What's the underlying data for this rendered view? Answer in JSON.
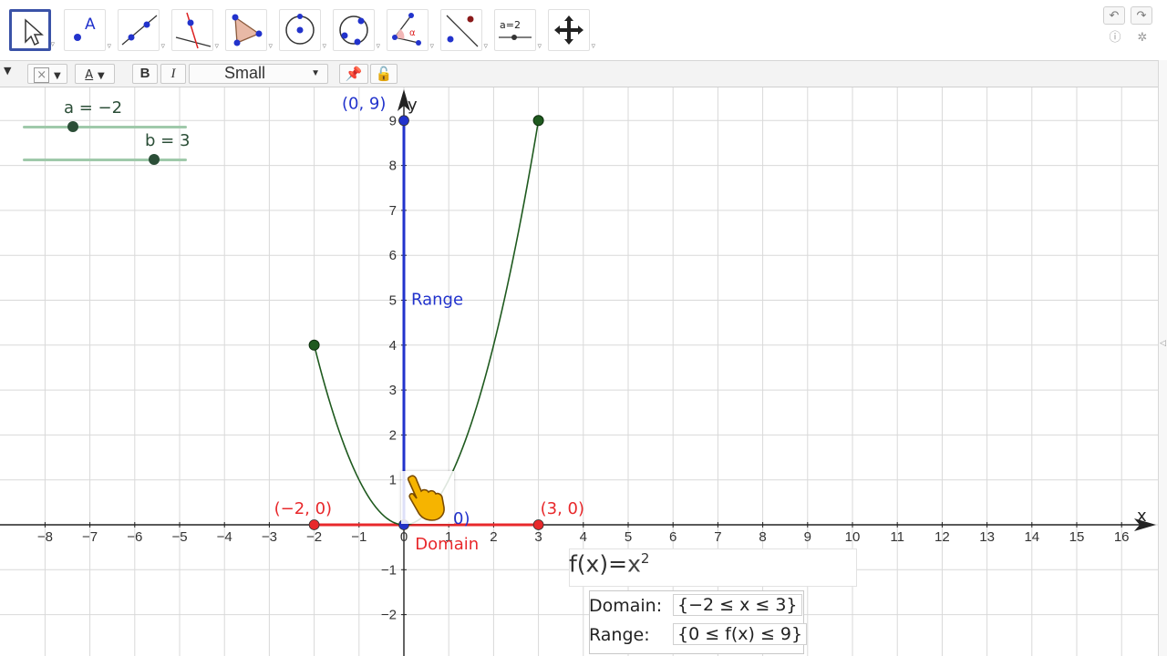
{
  "toolbar": {
    "tools": [
      {
        "id": "move",
        "icon": "pointer-icon",
        "active": true
      },
      {
        "id": "point",
        "icon": "point-icon"
      },
      {
        "id": "line",
        "icon": "line-icon"
      },
      {
        "id": "perpendicular",
        "icon": "perpendicular-line-icon"
      },
      {
        "id": "polygon",
        "icon": "polygon-icon"
      },
      {
        "id": "circle",
        "icon": "circle-center-point-icon"
      },
      {
        "id": "conic",
        "icon": "conic-icon"
      },
      {
        "id": "angle",
        "icon": "angle-icon"
      },
      {
        "id": "reflect",
        "icon": "reflect-icon"
      },
      {
        "id": "slider",
        "icon": "slider-icon",
        "label": "a=2"
      },
      {
        "id": "move-view",
        "icon": "move-graphics-view-icon"
      }
    ]
  },
  "stylebar": {
    "bold_label": "B",
    "italic_label": "I",
    "text_color_label": "A",
    "font_size": "Small"
  },
  "sliders": [
    {
      "label": "a = −2",
      "value": -2
    },
    {
      "label": "b = 3",
      "value": 3
    }
  ],
  "chart_data": {
    "type": "line",
    "function": "f(x) = x^2",
    "x_range": [
      -8.9,
      16.6
    ],
    "y_range": [
      -2.9,
      9.7
    ],
    "x_ticks": [
      -8,
      -7,
      -6,
      -5,
      -4,
      -3,
      -2,
      -1,
      0,
      1,
      2,
      3,
      4,
      5,
      6,
      7,
      8,
      9,
      10,
      11,
      12,
      13,
      14,
      15,
      16
    ],
    "y_ticks": [
      -2,
      -1,
      1,
      2,
      3,
      4,
      5,
      6,
      7,
      8,
      9
    ],
    "axis_labels": {
      "x": "x",
      "y": "y"
    },
    "grid": true,
    "curve": {
      "domain": [
        -2,
        3
      ],
      "color": "#1f5a1f"
    },
    "endpoints": [
      [
        -2,
        4
      ],
      [
        3,
        9
      ]
    ],
    "points": [
      {
        "x": -2,
        "y": 0,
        "label": "(−2, 0)",
        "color": "#e8282b"
      },
      {
        "x": 3,
        "y": 0,
        "label": "(3, 0)",
        "color": "#e8282b"
      },
      {
        "x": 0,
        "y": 9,
        "label": "(0, 9)",
        "color": "#2233cc"
      },
      {
        "x": 0,
        "y": 0,
        "label": "0)",
        "color": "#2233cc"
      }
    ],
    "domain_segment": {
      "from": -2,
      "to": 3,
      "label": "Domain",
      "color": "#e8282b"
    },
    "range_segment": {
      "from": 0,
      "to": 9,
      "label": "Range",
      "color": "#2233cc"
    }
  },
  "input_bar": {
    "prefix": "f(x)=",
    "body": "x",
    "exponent": "2"
  },
  "info": {
    "domain_label": "Domain:",
    "domain_value": "{−2 ≤ x ≤ 3}",
    "range_label": "Range:",
    "range_value": "{0 ≤ f(x) ≤ 9}"
  },
  "colors": {
    "accent": "#3a52a7",
    "domain_red": "#e8282b",
    "range_blue": "#2233cc",
    "curve_green": "#1f5a1f",
    "slider_green": "#2b4e37"
  }
}
